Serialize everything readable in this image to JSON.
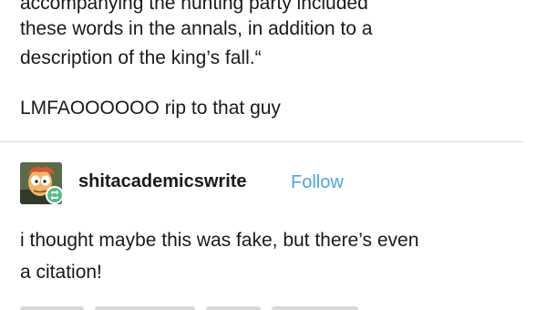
{
  "quoted_post": {
    "cut_line": "accompanying the hunting party included",
    "lines": [
      "these words in the annals, in addition to a",
      "description of the king’s fall.“"
    ]
  },
  "reply_1": {
    "text": "LMFAOOOOOO rip to that guy"
  },
  "reply_2": {
    "avatar_icon": "avatar-cartoon-icon",
    "badge_icon": "reblog-icon",
    "badge_color": "#56bc8a",
    "username": "shitacademicswrite",
    "follow_label": "Follow",
    "follow_color": "#4aa6e8",
    "lines": [
      "i thought maybe this was fake, but there’s even",
      "a citation!"
    ]
  }
}
